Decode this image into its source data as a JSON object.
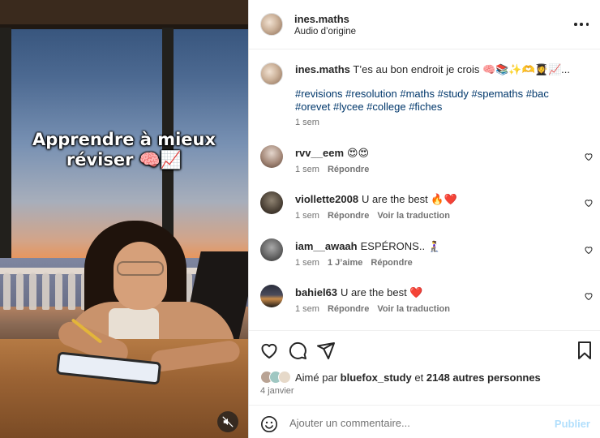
{
  "video": {
    "overlay_line1": "Apprendre à mieux",
    "overlay_line2": "réviser 🧠📈",
    "mute_icon": "volume-muted-icon"
  },
  "header": {
    "username": "ines.maths",
    "audio": "Audio d’origine",
    "more_icon": "more-options-icon"
  },
  "caption": {
    "username": "ines.maths",
    "text": "T’es au bon endroit je crois 🧠📚✨🫶👩‍🎓📈...",
    "hashtags": "#revisions #resolution #maths #study #spemaths #bac #orevet #lycee #college #fiches",
    "time": "1 sem"
  },
  "comments": [
    {
      "username": "rvv__eem",
      "text": "😍😍",
      "time": "1 sem",
      "actions": [
        "Répondre"
      ]
    },
    {
      "username": "viollette2008",
      "text": "U are the best 🔥❤️",
      "time": "1 sem",
      "actions": [
        "Répondre",
        "Voir la traduction"
      ]
    },
    {
      "username": "iam__awaah",
      "text": "ESPÉRONS.. 🧎‍♀️",
      "time": "1 sem",
      "actions": [
        "1 J’aime",
        "Répondre"
      ]
    },
    {
      "username": "bahiel63",
      "text": "U are the best ❤️",
      "time": "1 sem",
      "actions": [
        "Répondre",
        "Voir la traduction"
      ]
    }
  ],
  "actions": {
    "icons": [
      "heart-icon",
      "comment-icon",
      "share-icon",
      "bookmark-icon"
    ]
  },
  "likes": {
    "prefix": "Aimé par",
    "user": "bluefox_study",
    "connector": "et",
    "others": "2148 autres personnes"
  },
  "post_date": "4 janvier",
  "composer": {
    "placeholder": "Ajouter un commentaire...",
    "post_label": "Publier"
  },
  "colors": {
    "hashtag": "#00376b",
    "secondary_text": "#737373",
    "post_disabled": "#b2dffc",
    "heart_red": "#ed4956"
  }
}
